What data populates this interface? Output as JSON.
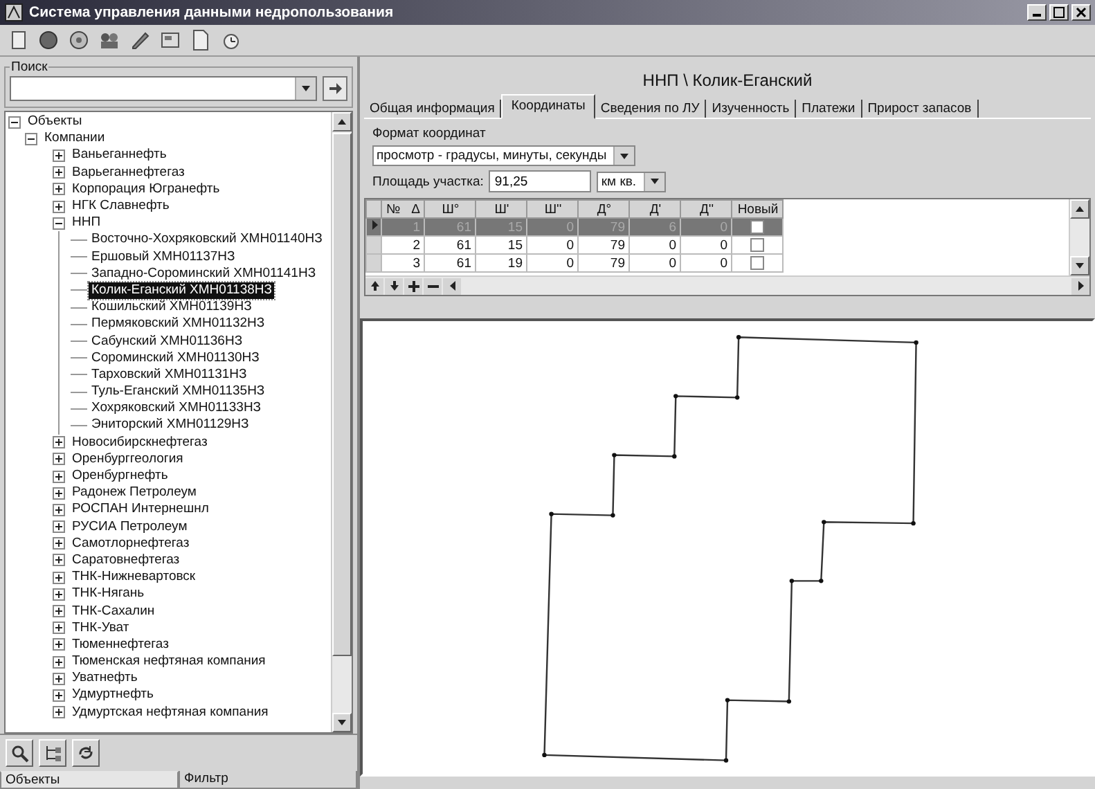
{
  "window": {
    "title": "Система управления данными недропользования"
  },
  "search": {
    "legend": "Поиск"
  },
  "tree": [
    {
      "label": "Объекты",
      "expanded": true,
      "selected": false,
      "children": [
        {
          "label": "Компании",
          "expanded": true,
          "selected": false,
          "children": [
            {
              "label": "Ваньеганнефть",
              "expanded": false,
              "selected": false
            },
            {
              "label": "Варьеганнефтегаз",
              "expanded": false,
              "selected": false
            },
            {
              "label": "Корпорация Югранефть",
              "expanded": false,
              "selected": false
            },
            {
              "label": "НГК Славнефть",
              "expanded": false,
              "selected": false
            },
            {
              "label": "ННП",
              "expanded": true,
              "selected": false,
              "children": [
                {
                  "label": "Восточно-Хохряковский ХМН01140НЗ",
                  "selected": false
                },
                {
                  "label": "Ершовый ХМН01137НЗ",
                  "selected": false
                },
                {
                  "label": "Западно-Сороминский ХМН01141НЗ",
                  "selected": false
                },
                {
                  "label": "Колик-Еганский ХМН01138НЗ",
                  "selected": true
                },
                {
                  "label": "Кошильский ХМН01139НЗ",
                  "selected": false
                },
                {
                  "label": "Пермяковский ХМН01132НЗ",
                  "selected": false
                },
                {
                  "label": "Сабунский ХМН01136НЗ",
                  "selected": false
                },
                {
                  "label": "Сороминский ХМН01130НЗ",
                  "selected": false
                },
                {
                  "label": "Тарховский ХМН01131НЗ",
                  "selected": false
                },
                {
                  "label": "Туль-Еганский ХМН01135НЗ",
                  "selected": false
                },
                {
                  "label": "Хохряковский ХМН01133НЗ",
                  "selected": false
                },
                {
                  "label": "Эниторский ХМН01129НЗ",
                  "selected": false
                }
              ]
            },
            {
              "label": "Новосибирскнефтегаз",
              "expanded": false,
              "selected": false
            },
            {
              "label": "Оренбурггеология",
              "expanded": false,
              "selected": false
            },
            {
              "label": "Оренбургнефть",
              "expanded": false,
              "selected": false
            },
            {
              "label": "Радонеж Петролеум",
              "expanded": false,
              "selected": false
            },
            {
              "label": "РОСПАН Интернешнл",
              "expanded": false,
              "selected": false
            },
            {
              "label": "РУСИА Петролеум",
              "expanded": false,
              "selected": false
            },
            {
              "label": "Самотлорнефтегаз",
              "expanded": false,
              "selected": false
            },
            {
              "label": "Саратовнефтегаз",
              "expanded": false,
              "selected": false
            },
            {
              "label": "ТНК-Нижневартовск",
              "expanded": false,
              "selected": false
            },
            {
              "label": "ТНК-Нягань",
              "expanded": false,
              "selected": false
            },
            {
              "label": "ТНК-Сахалин",
              "expanded": false,
              "selected": false
            },
            {
              "label": "ТНК-Уват",
              "expanded": false,
              "selected": false
            },
            {
              "label": "Тюменнефтегаз",
              "expanded": false,
              "selected": false
            },
            {
              "label": "Тюменская нефтяная компания",
              "expanded": false,
              "selected": false
            },
            {
              "label": "Уватнефть",
              "expanded": false,
              "selected": false
            },
            {
              "label": "Удмуртнефть",
              "expanded": false,
              "selected": false
            },
            {
              "label": "Удмуртская нефтяная компания",
              "expanded": false,
              "selected": false
            }
          ]
        }
      ]
    }
  ],
  "left_tabs": [
    {
      "label": "Объекты",
      "selected": true
    },
    {
      "label": "Фильтр",
      "selected": false
    }
  ],
  "heading": "ННП \\ Колик-Еганский",
  "tabs": [
    {
      "label": "Общая информация",
      "selected": false
    },
    {
      "label": "Координаты",
      "selected": true
    },
    {
      "label": "Сведения по ЛУ",
      "selected": false
    },
    {
      "label": "Изученность",
      "selected": false
    },
    {
      "label": "Платежи",
      "selected": false
    },
    {
      "label": "Прирост запасов",
      "selected": false
    }
  ],
  "format": {
    "label": "Формат координат",
    "value": "просмотр - градусы, минуты, секунды"
  },
  "area": {
    "label": "Площадь участка:",
    "value": "91,25",
    "unit": "км кв."
  },
  "grid": {
    "columns": [
      "№",
      "Ш°",
      "Ш'",
      "Ш''",
      "Д°",
      "Д'",
      "Д''",
      "Новый"
    ],
    "sort_mark": "Δ",
    "rows": [
      {
        "selected": true,
        "cells": [
          "1",
          "61",
          "15",
          "0",
          "79",
          "6",
          "0"
        ],
        "new": false
      },
      {
        "selected": false,
        "cells": [
          "2",
          "61",
          "15",
          "0",
          "79",
          "0",
          "0"
        ],
        "new": false
      },
      {
        "selected": false,
        "cells": [
          "3",
          "61",
          "19",
          "0",
          "79",
          "0",
          "0"
        ],
        "new": false
      }
    ]
  }
}
